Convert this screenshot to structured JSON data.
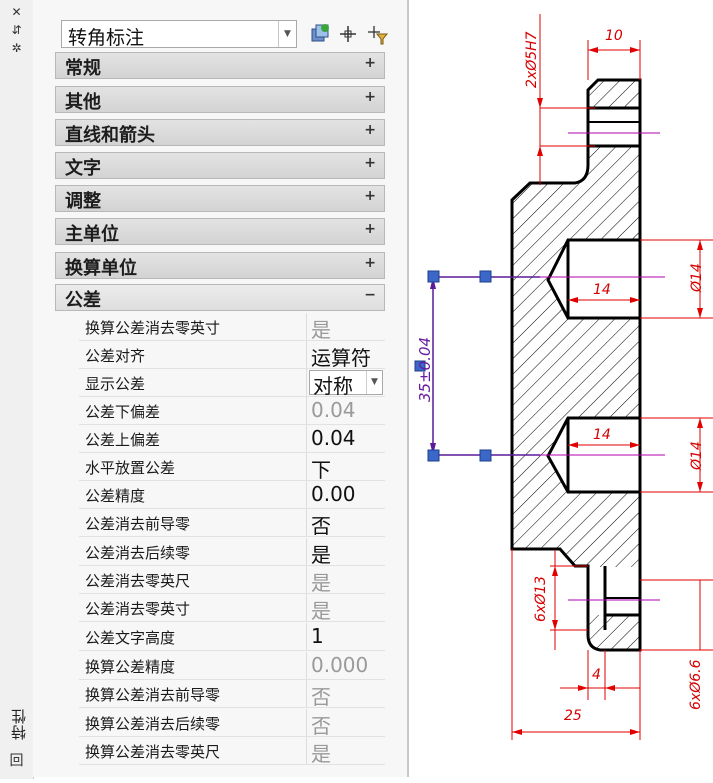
{
  "sidebar": {
    "close_glyph": "✕",
    "pin_glyph": "⇵",
    "options_glyph": "✲",
    "title": "特性",
    "bottom_glyph": "回"
  },
  "palette": {
    "type_select": "转角标注",
    "sections": [
      {
        "label": "常规",
        "expander": "+"
      },
      {
        "label": "其他",
        "expander": "+"
      },
      {
        "label": "直线和箭头",
        "expander": "+"
      },
      {
        "label": "文字",
        "expander": "+"
      },
      {
        "label": "调整",
        "expander": "+"
      },
      {
        "label": "主单位",
        "expander": "+"
      },
      {
        "label": "换算单位",
        "expander": "+"
      },
      {
        "label": "公差",
        "expander": "−"
      }
    ],
    "properties": [
      {
        "name": "换算公差消去零英寸",
        "value": "是",
        "dim": true
      },
      {
        "name": "公差对齐",
        "value": "运算符",
        "dim": false
      },
      {
        "name": "显示公差",
        "value": "对称",
        "dim": false,
        "combo": true
      },
      {
        "name": "公差下偏差",
        "value": "0.04",
        "dim": true
      },
      {
        "name": "公差上偏差",
        "value": "0.04",
        "dim": false
      },
      {
        "name": "水平放置公差",
        "value": "下",
        "dim": false
      },
      {
        "name": "公差精度",
        "value": "0.00",
        "dim": false
      },
      {
        "name": "公差消去前导零",
        "value": "否",
        "dim": false
      },
      {
        "name": "公差消去后续零",
        "value": "是",
        "dim": false
      },
      {
        "name": "公差消去零英尺",
        "value": "是",
        "dim": true
      },
      {
        "name": "公差消去零英寸",
        "value": "是",
        "dim": true
      },
      {
        "name": "公差文字高度",
        "value": "1",
        "dim": false
      },
      {
        "name": "换算公差精度",
        "value": "0.000",
        "dim": true
      },
      {
        "name": "换算公差消去前导零",
        "value": "否",
        "dim": true
      },
      {
        "name": "换算公差消去后续零",
        "value": "否",
        "dim": true
      },
      {
        "name": "换算公差消去零英尺",
        "value": "是",
        "dim": true
      }
    ]
  },
  "drawing": {
    "labels": {
      "hole_top": "2xØ5H7",
      "dim_10": "10",
      "dim_14a": "14",
      "dim_14b": "14",
      "dia14a": "Ø14",
      "dia14b": "Ø14",
      "selected_dim": "35±0.04",
      "hole_13": "6xØ13",
      "hole_66": "6xØ6.6",
      "dim_4": "4",
      "dim_25": "25"
    },
    "colors": {
      "outline": "#000000",
      "dimension": "#e00000",
      "center": "#b000b0",
      "selected": "#5a1a9a",
      "grip": "#3a67c8"
    }
  }
}
